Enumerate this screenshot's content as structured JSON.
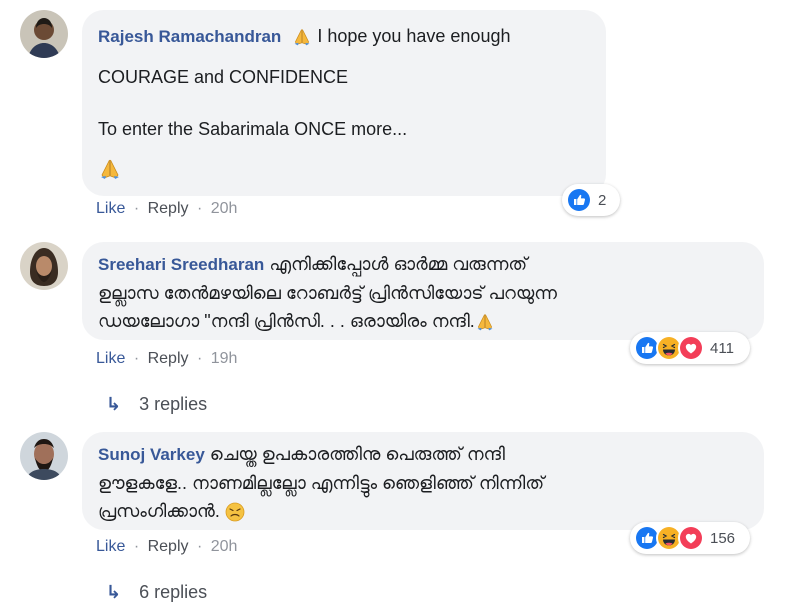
{
  "comments": [
    {
      "author": "Rajesh Ramachandran",
      "lines": [
        " I hope you have enough",
        "COURAGE and CONFIDENCE",
        "",
        "To enter the Sabarimala ONCE more..."
      ],
      "actions": {
        "like": "Like",
        "reply": "Reply",
        "sep": "·",
        "time": "20h"
      },
      "reaction_count": "2"
    },
    {
      "author": "Sreehari Sreedharan",
      "lines": [
        " എനിക്കിപ്പോൾ ഓർമ്മ വരുന്നത്",
        "ഉല്ലാസ തേൻമഴയിലെ റോബർട്ട് പ്രിൻസിയോട് പറയുന്ന",
        "ഡയലോഗാ \"നന്ദി പ്രിൻസി. . . ഒരായിരം നന്ദി."
      ],
      "actions": {
        "like": "Like",
        "reply": "Reply",
        "sep": "·",
        "time": "19h"
      },
      "reaction_count": "411",
      "replies_label": "3 replies"
    },
    {
      "author": "Sunoj Varkey",
      "lines": [
        " ചെയ്ത ഉപകാരത്തിനു പെരുത്ത് നന്ദി",
        "ഊളകളേ.. നാണമില്ലല്ലോ എന്നിട്ടും ഞെളിഞ്ഞ് നിന്നിത്",
        "പ്രസംഗിക്കാൻ."
      ],
      "actions": {
        "like": "Like",
        "reply": "Reply",
        "sep": "·",
        "time": "20h"
      },
      "reaction_count": "156",
      "replies_label": "6 replies"
    }
  ],
  "colors": {
    "author": "#385898",
    "bubble": "#f2f3f5",
    "like_reaction": "#1877f2",
    "haha_reaction": "#f7b125",
    "love_reaction": "#f33e58"
  },
  "icons": [
    "folded-hands-emoji",
    "like-reaction-icon",
    "haha-reaction-icon",
    "love-reaction-icon",
    "reply-arrow-icon",
    "angry-face-emoji"
  ]
}
